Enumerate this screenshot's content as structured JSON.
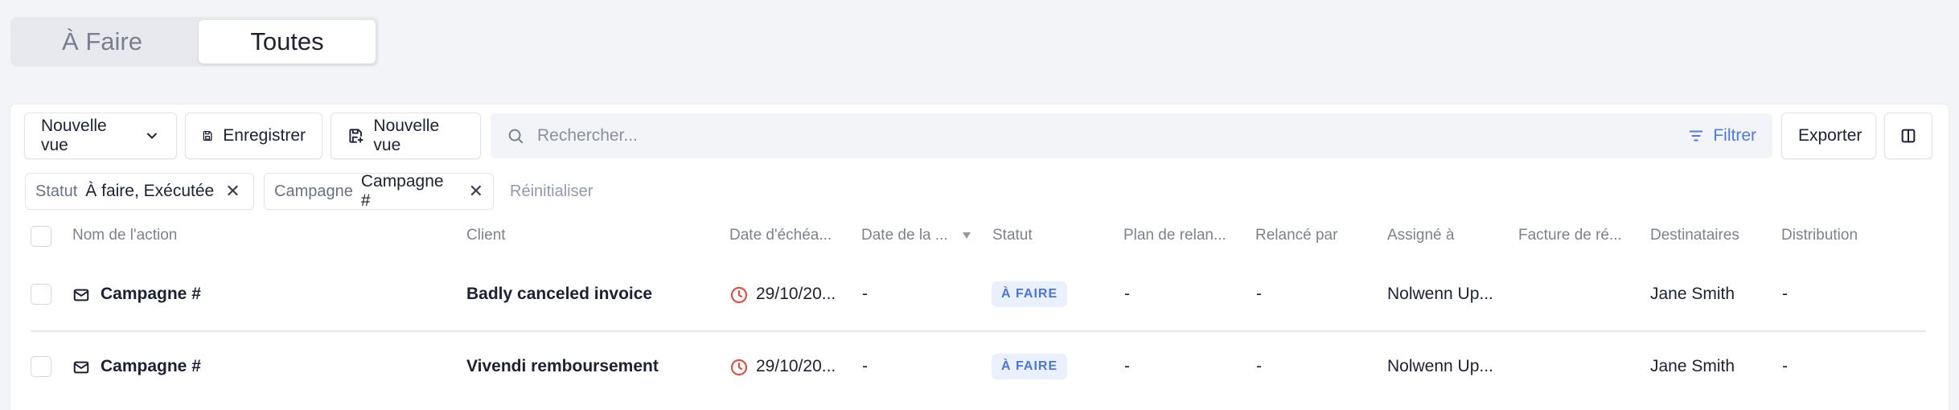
{
  "tabs": [
    {
      "label": "À Faire",
      "active": false
    },
    {
      "label": "Toutes",
      "active": true
    }
  ],
  "toolbar": {
    "view_select": "Nouvelle vue",
    "save_label": "Enregistrer",
    "new_view_label": "Nouvelle vue",
    "search_placeholder": "Rechercher...",
    "filter_label": "Filtrer",
    "export_label": "Exporter"
  },
  "filters": [
    {
      "key": "Statut",
      "value": "À faire, Exécutée"
    },
    {
      "key": "Campagne",
      "value": "Campagne #"
    }
  ],
  "reset_label": "Réinitialiser",
  "columns": [
    "Nom de l'action",
    "Client",
    "Date d'échéa...",
    "Date de la ...",
    "Statut",
    "Plan de relan...",
    "Relancé par",
    "Assigné à",
    "Facture de ré...",
    "Destinataires",
    "Distribution"
  ],
  "rows": [
    {
      "action": "Campagne #",
      "client": "Badly canceled invoice",
      "due": "29/10/20...",
      "date": "-",
      "status": "À FAIRE",
      "plan": "-",
      "relance": "-",
      "assigned": "Nolwenn Up...",
      "invoice": "",
      "recipients": "Jane Smith",
      "distribution": "-"
    },
    {
      "action": "Campagne #",
      "client": "Vivendi remboursement",
      "due": "29/10/20...",
      "date": "-",
      "status": "À FAIRE",
      "plan": "-",
      "relance": "-",
      "assigned": "Nolwenn Up...",
      "invoice": "",
      "recipients": "Jane Smith",
      "distribution": "-"
    }
  ],
  "colors": {
    "accent": "#4a7be8",
    "clock": "#e0523f",
    "badge_bg": "#eaf0fd"
  }
}
